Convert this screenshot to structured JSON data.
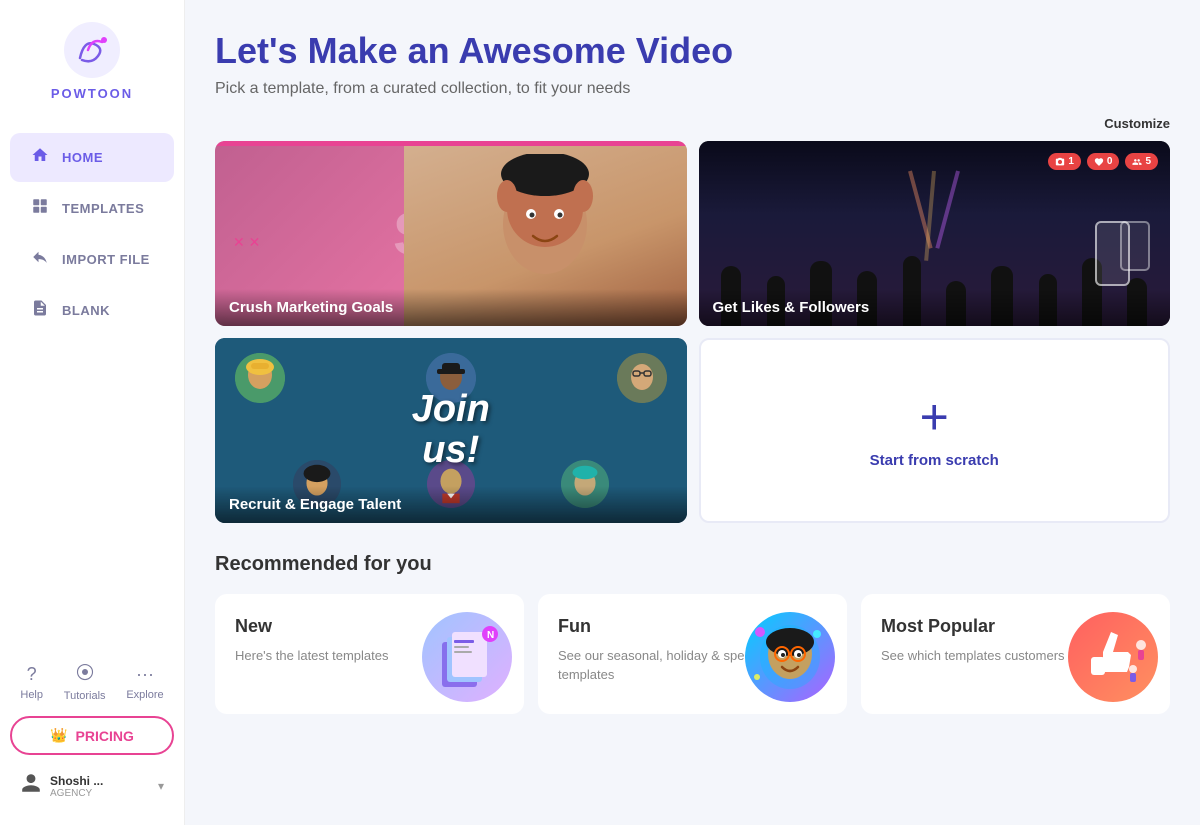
{
  "sidebar": {
    "logo_text": "POWTOON",
    "nav_items": [
      {
        "id": "home",
        "label": "HOME",
        "icon": "home",
        "active": true
      },
      {
        "id": "templates",
        "label": "TEMPLATES",
        "icon": "templates",
        "active": false
      },
      {
        "id": "import",
        "label": "IMPORT FILE",
        "icon": "import",
        "active": false
      },
      {
        "id": "blank",
        "label": "BLANK",
        "icon": "blank",
        "active": false
      }
    ],
    "help": {
      "items": [
        {
          "id": "help",
          "label": "Help",
          "icon": "?"
        },
        {
          "id": "tutorials",
          "label": "Tutorials",
          "icon": "👁"
        },
        {
          "id": "explore",
          "label": "Explore",
          "icon": "···"
        }
      ]
    },
    "pricing_label": "PRICING",
    "user": {
      "name": "Shoshi ...",
      "role": "AGENCY"
    }
  },
  "main": {
    "title": "Let's Make an Awesome Video",
    "subtitle": "Pick a template, from a curated collection, to fit your needs",
    "customize_label": "Customize",
    "templates": [
      {
        "id": "marketing",
        "label": "Crush Marketing Goals"
      },
      {
        "id": "social",
        "label": "Get Likes & Followers"
      },
      {
        "id": "recruit",
        "label": "Recruit & Engage Talent"
      }
    ],
    "scratch": {
      "plus": "+",
      "label": "Start from scratch"
    },
    "notifications": {
      "camera": "1",
      "heart": "0",
      "people": "5"
    },
    "recommended": {
      "title": "Recommended for you",
      "cards": [
        {
          "id": "new",
          "title": "New",
          "desc": "Here's the latest templates",
          "thumb_text": "📋"
        },
        {
          "id": "fun",
          "title": "Fun",
          "desc": "See our seasonal, holiday & special event templates",
          "thumb_text": "😄"
        },
        {
          "id": "popular",
          "title": "Most Popular",
          "desc": "See which templates customers love the most",
          "thumb_text": "👍"
        }
      ]
    }
  },
  "colors": {
    "brand_purple": "#6b5ce7",
    "brand_blue": "#3a3caf",
    "accent_pink": "#e84393",
    "sidebar_bg": "#ffffff"
  }
}
